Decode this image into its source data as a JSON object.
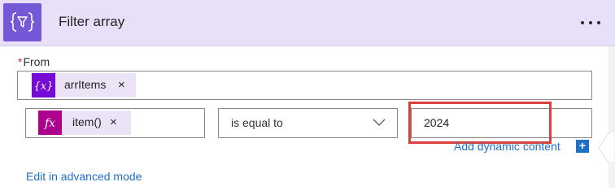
{
  "header": {
    "title": "Filter array",
    "icon": "filter-braces-icon",
    "color": "#7458d6",
    "more_icon": "more-horizontal-icon"
  },
  "from": {
    "label": "From",
    "required_marker": "*",
    "token": {
      "label": "arrItems",
      "icon": "variable-icon",
      "close": "×",
      "icon_color": "#770bd6"
    }
  },
  "condition": {
    "left_token": {
      "label": "item()",
      "icon": "function-icon",
      "close": "×",
      "icon_color": "#ad008c"
    },
    "operator": {
      "value": "is equal to",
      "icon": "chevron-down-icon"
    },
    "right_value": "2024"
  },
  "dynamic_content": {
    "label": "Add dynamic content",
    "button": "+"
  },
  "advanced_mode_link": "Edit in advanced mode",
  "colors": {
    "header_bg": "#e8e0f8",
    "link": "#1f6fc5",
    "highlight": "#d9413f"
  }
}
